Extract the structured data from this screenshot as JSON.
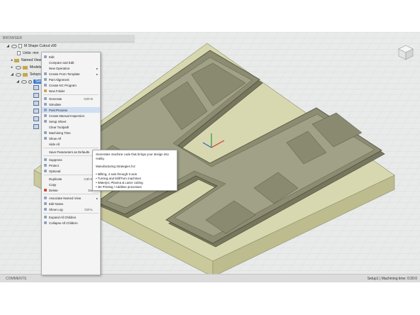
{
  "browser": {
    "header": "BROWSER",
    "document_name": "M Shape Cutout v90",
    "units": "Units: mm",
    "named_views": "Named Views",
    "models": "Models",
    "setups": "Setups",
    "setup": "Setup1"
  },
  "context_menu": {
    "items": [
      {
        "label": "Edit"
      },
      {
        "label": "Compare and Edit"
      },
      {
        "label": "New Operation",
        "submenu": "▸"
      },
      {
        "label": "Create From Template",
        "submenu": "▸"
      },
      {
        "label": "Part Alignment"
      },
      {
        "label": "Create NC Program"
      },
      {
        "label": "New Folder"
      },
      {
        "label": "Generate",
        "shortcut": "Ctrl+G"
      },
      {
        "label": "Simulate"
      },
      {
        "label": "Post Process"
      },
      {
        "label": "Create Manual Inspection"
      },
      {
        "label": "Setup Sheet"
      },
      {
        "label": "Clear Toolpath"
      },
      {
        "label": "Machining Time"
      },
      {
        "label": "Show All"
      },
      {
        "label": "Hide All"
      },
      {
        "label": "Save Parameters as Defaults"
      },
      {
        "label": "Suppress"
      },
      {
        "label": "Protect"
      },
      {
        "label": "Optional"
      },
      {
        "label": "Duplicate",
        "shortcut": "Ctrl+D"
      },
      {
        "label": "Copy"
      },
      {
        "label": "Delete",
        "shortcut": "Del"
      },
      {
        "label": "Associate Named View",
        "submenu": "▸"
      },
      {
        "label": "Edit Notes"
      },
      {
        "label": "Show Log",
        "shortcut": "Ctrl+L"
      },
      {
        "label": "Expand All Children"
      },
      {
        "label": "Collapse All Children"
      }
    ]
  },
  "tooltip": {
    "line1": "Generates machine code that brings your design into",
    "line2": "reality.",
    "heading": "Manufacturing Strategies for:",
    "bullets": [
      "• Milling, 2 axis through 5 axis",
      "• Turning and Mill/Turn machines",
      "• Waterjet, Plasma & Laser cutting",
      "• 3D Printing / Additive processes"
    ]
  },
  "statusbar": {
    "comments": "COMMENTS",
    "status": "Setup1 | Machining time: 0:20:0"
  },
  "colors": {
    "stock": "#d8d8ad",
    "part": "#8c8c72",
    "part_top": "#a1a187",
    "highlight": "#cfdef3",
    "selection": "#3a7bd5"
  }
}
